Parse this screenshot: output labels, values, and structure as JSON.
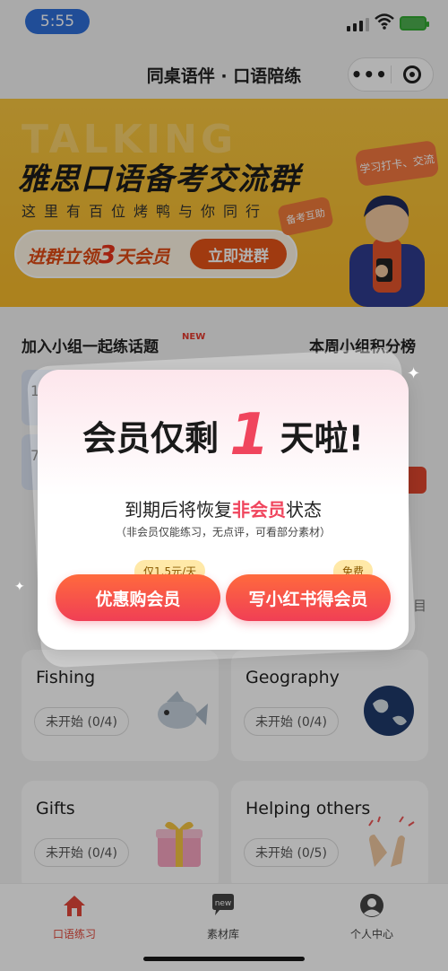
{
  "status": {
    "time": "5:55"
  },
  "nav": {
    "title": "同桌语伴 · 口语陪练",
    "menu_icon": "more-dots-icon",
    "close_icon": "target-icon"
  },
  "banner": {
    "bg_text": "TALKING",
    "title": "雅思口语备考交流群",
    "subtitle": "这里有百位烤鸭与你同行",
    "cta_prefix": "进群立领",
    "cta_number": "3",
    "cta_suffix": "天会员",
    "cta_button": "立即进群",
    "bubble1": "学习打卡、交流",
    "bubble2": "备考互助",
    "accent": "#f6b92a"
  },
  "sections": {
    "left_title": "加入小组一起练话题",
    "left_badge": "NEW",
    "right_title": "本周小组积分榜",
    "peek_text_1": "1",
    "peek_text_2": "7",
    "peek_right": "目"
  },
  "cards": [
    {
      "title": "Fishing",
      "status": "未开始 (0/4)",
      "icon": "fish-icon"
    },
    {
      "title": "Geography",
      "status": "未开始 (0/4)",
      "icon": "earth-icon"
    },
    {
      "title": "Gifts",
      "status": "未开始 (0/4)",
      "icon": "gift-icon"
    },
    {
      "title": "Helping others",
      "status": "未开始 (0/5)",
      "icon": "clapping-hands-icon"
    }
  ],
  "tabs": [
    {
      "label": "口语练习",
      "icon": "home-icon",
      "active": true
    },
    {
      "label": "素材库",
      "icon": "chat-new-icon",
      "badge": "new",
      "active": false
    },
    {
      "label": "个人中心",
      "icon": "user-icon",
      "active": false
    }
  ],
  "modal": {
    "headline_pre": "会员仅剩",
    "headline_num": "1",
    "headline_post": "天啦!",
    "line2_pre": "到期后将恢复",
    "line2_highlight": "非会员",
    "line2_post": "状态",
    "line3": "（非会员仅能练习，无点评，可看部分素材）",
    "btn_left": "优惠购会员",
    "btn_left_tag": "仅1.5元/天",
    "btn_right": "写小红书得会员",
    "btn_right_tag": "免费",
    "accent": "#f0455d"
  }
}
